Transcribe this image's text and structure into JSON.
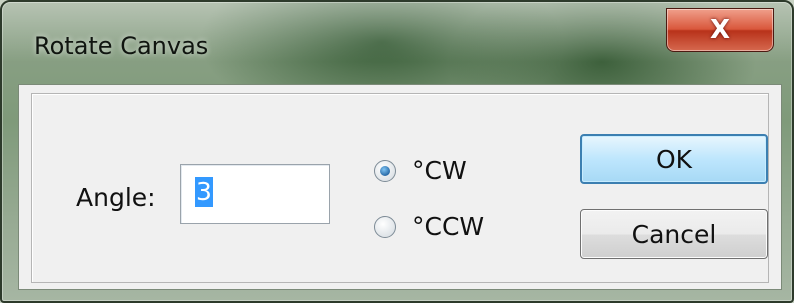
{
  "window": {
    "title": "Rotate Canvas",
    "close_label": "X"
  },
  "form": {
    "angle_label": "Angle:",
    "angle_value": "3"
  },
  "rotation": {
    "options": [
      {
        "label": "°CW",
        "selected": true
      },
      {
        "label": "°CCW",
        "selected": false
      }
    ]
  },
  "buttons": {
    "ok_label": "OK",
    "cancel_label": "Cancel"
  },
  "colors": {
    "selection": "#3399ff",
    "ok_border": "#3c7fb1",
    "close_red": "#c7442b",
    "dialog_bg": "#f0f0f0"
  }
}
